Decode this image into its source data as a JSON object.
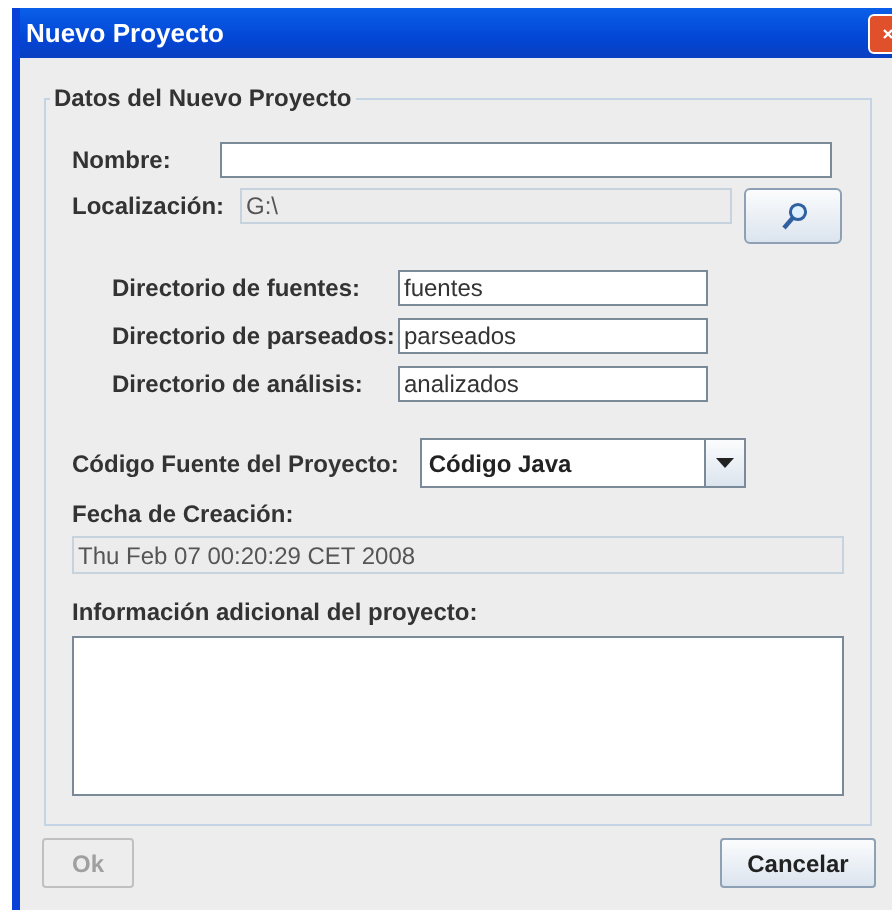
{
  "window": {
    "title": "Nuevo Proyecto"
  },
  "group": {
    "legend": "Datos del Nuevo Proyecto"
  },
  "name_field": {
    "label": "Nombre:"
  },
  "location": {
    "label": "Localización:",
    "value": "G:\\",
    "disabled": true
  },
  "directories": [
    {
      "label": "Directorio de fuentes:",
      "value": "fuentes"
    },
    {
      "label": "Directorio de parseados:",
      "value": "parseados"
    },
    {
      "label": "Directorio de análisis:",
      "value": "analizados"
    }
  ],
  "source_code": {
    "label": "Código Fuente del Proyecto:",
    "value": "Código Java"
  },
  "creation_date": {
    "label": "Fecha de Creación:",
    "value": "Thu Feb 07 00:20:29 CET 2008",
    "disabled": true
  },
  "additional_info": {
    "label": "Información adicional del proyecto:"
  },
  "buttons": [
    {
      "label": "Ok",
      "disabled": true
    },
    {
      "label": "Cancelar",
      "disabled": false
    }
  ]
}
